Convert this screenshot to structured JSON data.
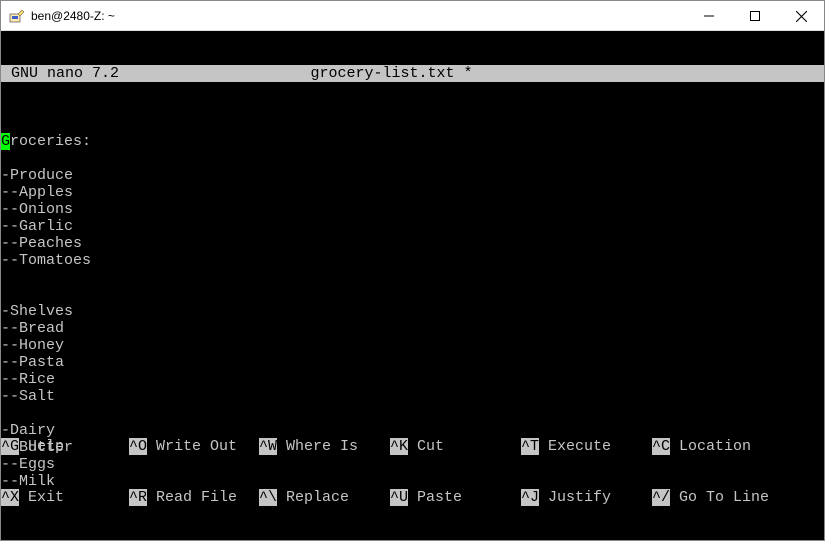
{
  "titlebar": {
    "title": "ben@2480-Z: ~"
  },
  "editor": {
    "app": "GNU nano 7.2",
    "filename": "grocery-list.txt *"
  },
  "lines": [
    "Groceries:",
    "",
    "-Produce",
    "--Apples",
    "--Onions",
    "--Garlic",
    "--Peaches",
    "--Tomatoes",
    "",
    "",
    "-Shelves",
    "--Bread",
    "--Honey",
    "--Pasta",
    "--Rice",
    "--Salt",
    "",
    "-Dairy",
    "--Butter",
    "--Eggs",
    "--Milk"
  ],
  "cursor": {
    "line": 0,
    "col": 0
  },
  "shortcuts": {
    "row1": [
      {
        "key": "^G",
        "label": "Help"
      },
      {
        "key": "^O",
        "label": "Write Out"
      },
      {
        "key": "^W",
        "label": "Where Is"
      },
      {
        "key": "^K",
        "label": "Cut"
      },
      {
        "key": "^T",
        "label": "Execute"
      },
      {
        "key": "^C",
        "label": "Location"
      }
    ],
    "row2": [
      {
        "key": "^X",
        "label": "Exit"
      },
      {
        "key": "^R",
        "label": "Read File"
      },
      {
        "key": "^\\",
        "label": "Replace"
      },
      {
        "key": "^U",
        "label": "Paste"
      },
      {
        "key": "^J",
        "label": "Justify"
      },
      {
        "key": "^/",
        "label": "Go To Line"
      }
    ]
  }
}
